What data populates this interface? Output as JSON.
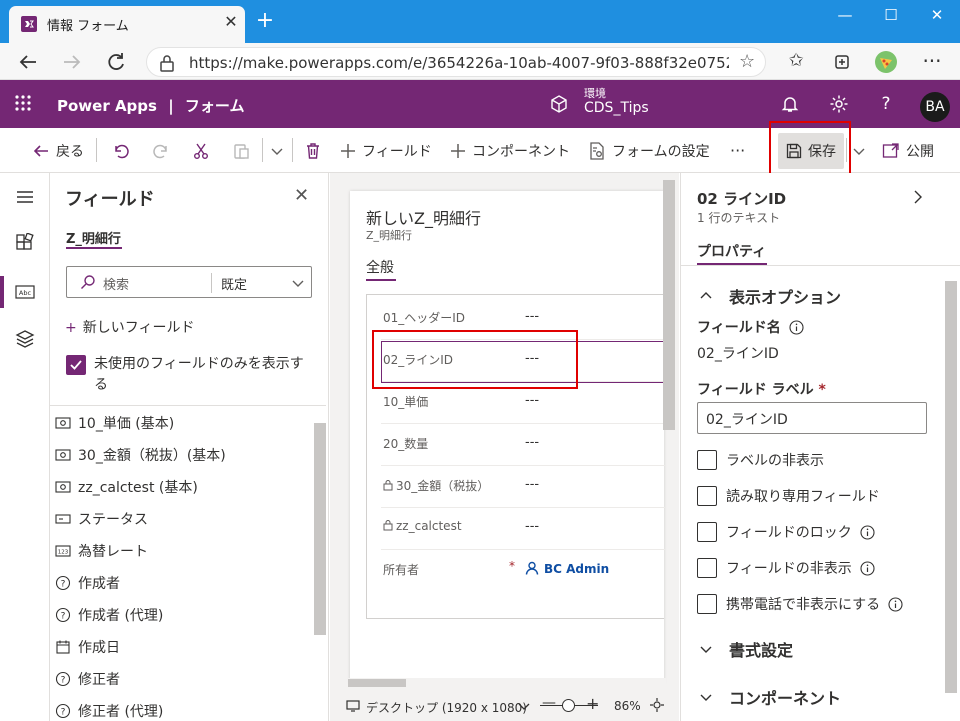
{
  "browser": {
    "tab_title": "情報 フォーム",
    "url": "https://make.powerapps.com/e/3654226a-10ab-4007-9f03-888f32e07526..."
  },
  "app": {
    "name": "Power Apps",
    "separator": "|",
    "section": "フォーム",
    "env_label": "環境",
    "env_name": "CDS_Tips",
    "user_initials": "BA"
  },
  "commands": {
    "back": "戻る",
    "field": "フィールド",
    "component": "コンポーネント",
    "form_settings": "フォームの設定",
    "more": "···",
    "save": "保存",
    "publish": "公開"
  },
  "fields_pane": {
    "title": "フィールド",
    "entity": "Z_明細行",
    "search_placeholder": "検索",
    "filter_value": "既定",
    "new_field": "新しいフィールド",
    "unused_only": "未使用のフィールドのみを表示する",
    "items": [
      {
        "icon": "currency-icon",
        "label": "10_単価 (基本)"
      },
      {
        "icon": "currency-icon",
        "label": "30_金額（税抜）(基本)"
      },
      {
        "icon": "currency-icon",
        "label": "zz_calctest (基本)"
      },
      {
        "icon": "status-icon",
        "label": "ステータス"
      },
      {
        "icon": "number-icon",
        "label": "為替レート"
      },
      {
        "icon": "question-icon",
        "label": "作成者"
      },
      {
        "icon": "question-icon",
        "label": "作成者 (代理)"
      },
      {
        "icon": "calendar-icon",
        "label": "作成日"
      },
      {
        "icon": "question-icon",
        "label": "修正者"
      },
      {
        "icon": "question-icon",
        "label": "修正者 (代理)"
      }
    ]
  },
  "canvas": {
    "form_title": "新しいZ_明細行",
    "form_entity": "Z_明細行",
    "tab": "全般",
    "rows": [
      {
        "label": "01_ヘッダーID",
        "value": "---",
        "locked": false,
        "required": false
      },
      {
        "label": "02_ラインID",
        "value": "---",
        "locked": false,
        "required": false
      },
      {
        "label": "10_単価",
        "value": "---",
        "locked": false,
        "required": false
      },
      {
        "label": "20_数量",
        "value": "---",
        "locked": false,
        "required": false
      },
      {
        "label": "30_金額（税抜）",
        "value": "---",
        "locked": true,
        "required": false
      },
      {
        "label": "zz_calctest",
        "value": "---",
        "locked": true,
        "required": false
      },
      {
        "label": "所有者",
        "value": "BC Admin",
        "locked": false,
        "required": true
      }
    ],
    "required_mark": "*",
    "view_mode": "デスクトップ (1920 x 1080)",
    "zoom": "86%"
  },
  "properties": {
    "title": "02 ラインID",
    "subtitle": "1 行のテキスト",
    "tab": "プロパティ",
    "display_options": "表示オプション",
    "field_name_label": "フィールド名",
    "field_name_value": "02_ラインID",
    "field_label_label": "フィールド ラベル",
    "required_mark": "*",
    "field_label_value": "02_ラインID",
    "checkboxes": [
      "ラベルの非表示",
      "読み取り専用フィールド",
      "フィールドのロック",
      "フィールドの非表示",
      "携帯電話で非表示にする"
    ],
    "formatting": "書式設定",
    "components": "コンポーネント"
  },
  "colors": {
    "brand": "#742774",
    "highlight": "#e00000",
    "link": "#0f4ea3"
  }
}
